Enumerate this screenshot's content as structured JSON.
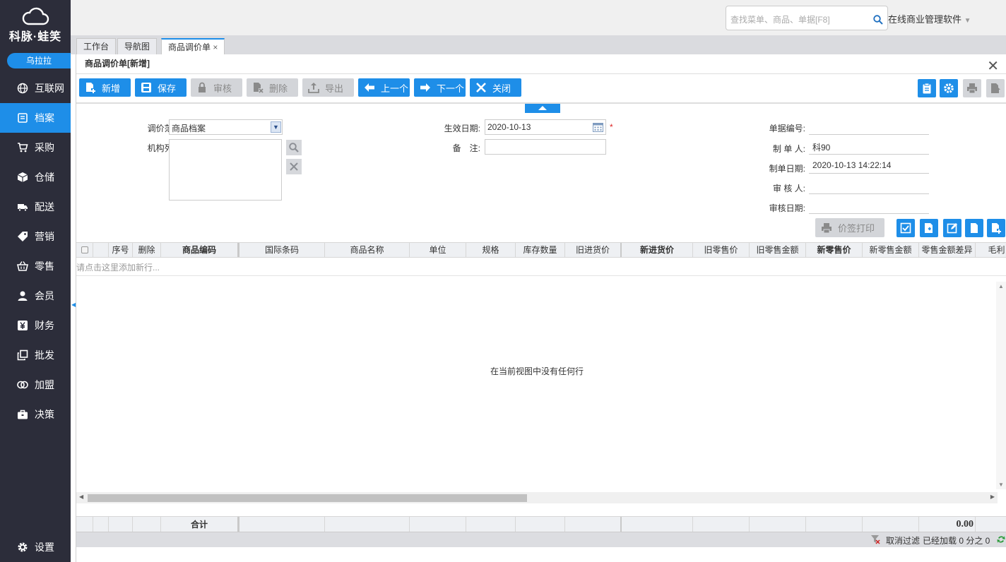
{
  "sidebar": {
    "logo_text": "科脉·蛙笑",
    "user": "乌拉拉",
    "items": [
      {
        "label": "互联网",
        "icon": "globe-icon"
      },
      {
        "label": "档案",
        "icon": "file-icon"
      },
      {
        "label": "采购",
        "icon": "cart-icon"
      },
      {
        "label": "仓储",
        "icon": "box-icon"
      },
      {
        "label": "配送",
        "icon": "truck-icon"
      },
      {
        "label": "营销",
        "icon": "tag-icon"
      },
      {
        "label": "零售",
        "icon": "basket-icon"
      },
      {
        "label": "会员",
        "icon": "user-icon"
      },
      {
        "label": "财务",
        "icon": "yen-icon"
      },
      {
        "label": "批发",
        "icon": "copy-icon"
      },
      {
        "label": "加盟",
        "icon": "rings-icon"
      },
      {
        "label": "决策",
        "icon": "briefcase-icon"
      }
    ],
    "settings": "设置"
  },
  "topbar": {
    "search_placeholder": "查找菜单、商品、单据[F8]",
    "brand": "在线商业管理软件"
  },
  "tabs": [
    {
      "label": "工作台"
    },
    {
      "label": "导航图"
    },
    {
      "label": "商品调价单"
    }
  ],
  "panel": {
    "title": "商品调价单[新增]",
    "toolbar": {
      "new": "新增",
      "save": "保存",
      "audit": "审核",
      "delete": "删除",
      "export": "导出",
      "prev": "上一个",
      "next": "下一个",
      "close": "关闭"
    },
    "form": {
      "scope_label": "调价范围:",
      "scope_value": "商品档案",
      "org_label": "机构列表:",
      "effective_label": "生效日期:",
      "effective_value": "2020-10-13",
      "required_mark": "*",
      "remark_label": "备　注:",
      "remark_value": "",
      "docno_label": "单据编号:",
      "docno_value": "",
      "maker_label": "制 单 人:",
      "maker_value": "科90",
      "makedate_label": "制单日期:",
      "makedate_value": "2020-10-13 14:22:14",
      "auditor_label": "审 核 人:",
      "auditor_value": "",
      "auditdate_label": "审核日期:",
      "auditdate_value": ""
    },
    "price_print": "价签打印",
    "grid": {
      "columns": [
        "序号",
        "删除",
        "商品编码",
        "国际条码",
        "商品名称",
        "单位",
        "规格",
        "库存数量",
        "旧进货价",
        "新进货价",
        "旧零售价",
        "旧零售金额",
        "新零售价",
        "新零售金额",
        "零售金额差异",
        "毛利"
      ],
      "add_row_hint": "请点击这里添加新行...",
      "empty_text": "在当前视图中没有任何行",
      "total_label": "合计",
      "total_value": "0.00"
    },
    "status": {
      "cancel_filter": "取消过滤",
      "loaded": "已经加载 0 分之 0"
    }
  }
}
